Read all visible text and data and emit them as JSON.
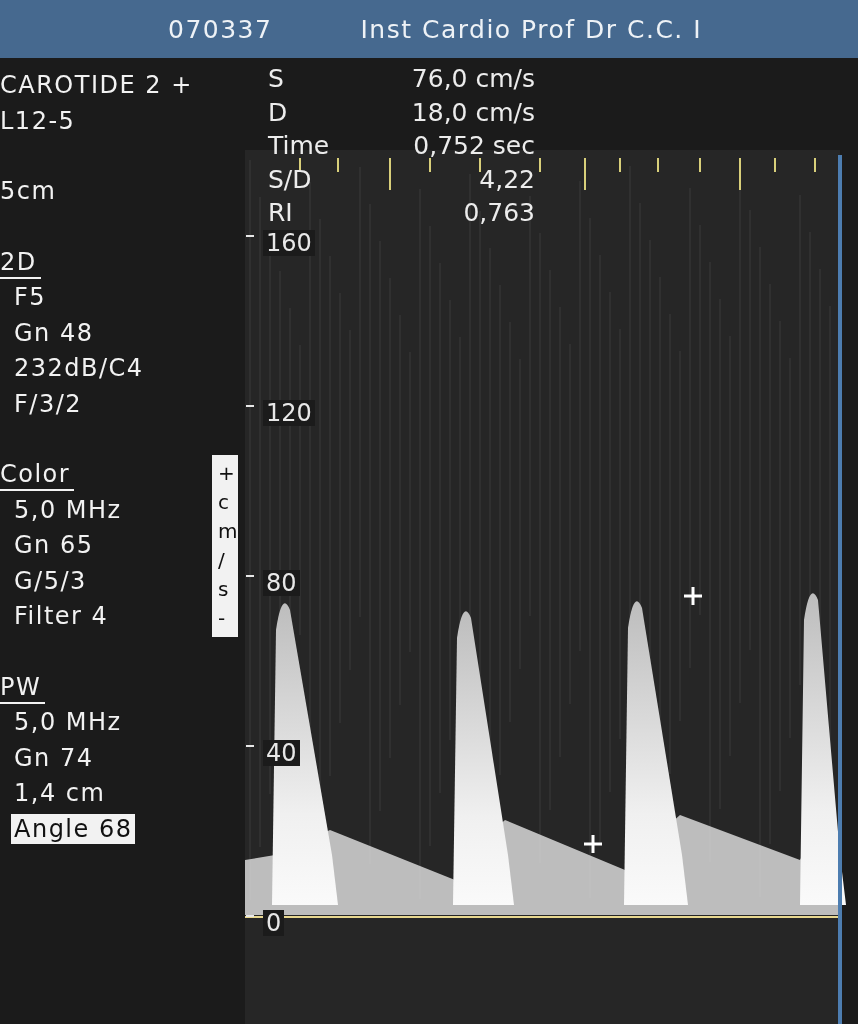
{
  "header": {
    "patient_id": "070337",
    "institution": "Inst Cardio Prof Dr C.C. I"
  },
  "exam": {
    "title": "CAROTIDE 2 +",
    "probe": "L12-5",
    "depth": "5cm"
  },
  "sections": [
    {
      "title": "2D",
      "items": [
        {
          "text": "F5",
          "highlighted": false
        },
        {
          "text": "Gn 48",
          "highlighted": false
        },
        {
          "text": "232dB/C4",
          "highlighted": false
        },
        {
          "text": "F/3/2",
          "highlighted": false
        }
      ]
    },
    {
      "title": "Color",
      "items": [
        {
          "text": "5,0 MHz",
          "highlighted": false
        },
        {
          "text": "Gn 65",
          "highlighted": false
        },
        {
          "text": "G/5/3",
          "highlighted": false
        },
        {
          "text": "Filter 4",
          "highlighted": false
        }
      ]
    },
    {
      "title": "PW",
      "items": [
        {
          "text": "5,0 MHz",
          "highlighted": false
        },
        {
          "text": "Gn 74",
          "highlighted": false
        },
        {
          "text": "1,4 cm",
          "highlighted": false
        },
        {
          "text": "Angle 68",
          "highlighted": true
        }
      ]
    }
  ],
  "measurements": [
    {
      "label": "S",
      "value": "76,0 cm/s"
    },
    {
      "label": "D",
      "value": "18,0 cm/s"
    },
    {
      "label": "Time",
      "value": "0,752 sec"
    },
    {
      "label": "S/D",
      "value": "4,22"
    },
    {
      "label": "RI",
      "value": "0,763"
    }
  ],
  "velocity_scale": {
    "unit": "+cm/s-",
    "ticks": [
      "160",
      "120",
      "80",
      "40",
      "0"
    ]
  }
}
